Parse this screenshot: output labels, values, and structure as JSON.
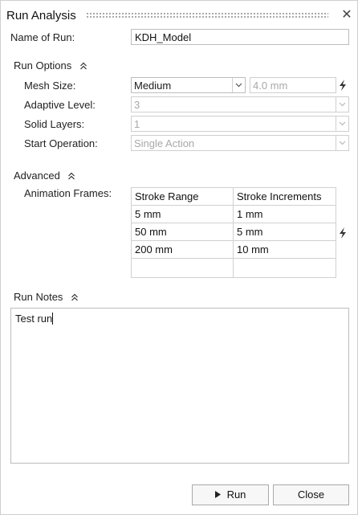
{
  "window": {
    "title": "Run Analysis",
    "close_icon": "close-icon"
  },
  "run_name": {
    "label": "Name of Run:",
    "value": "KDH_Model"
  },
  "run_options": {
    "header": "Run Options",
    "mesh_size": {
      "label": "Mesh Size:",
      "value": "Medium",
      "size_value": "4.0 mm"
    },
    "adaptive_level": {
      "label": "Adaptive Level:",
      "value": "3"
    },
    "solid_layers": {
      "label": "Solid Layers:",
      "value": "1"
    },
    "start_operation": {
      "label": "Start Operation:",
      "value": "Single Action"
    }
  },
  "advanced": {
    "header": "Advanced",
    "animation_frames": {
      "label": "Animation Frames:",
      "columns": [
        "Stroke Range",
        "Stroke Increments"
      ],
      "rows": [
        [
          "5 mm",
          "1 mm"
        ],
        [
          "50 mm",
          "5 mm"
        ],
        [
          "200 mm",
          "10 mm"
        ],
        [
          "",
          ""
        ]
      ]
    }
  },
  "run_notes": {
    "header": "Run Notes",
    "value": "Test run"
  },
  "buttons": {
    "run": "Run",
    "close": "Close"
  },
  "icons": {
    "collapse": "chevron-up-double-icon",
    "lightning": "lightning-icon",
    "dropdown": "chevron-down-icon",
    "play": "play-icon"
  }
}
